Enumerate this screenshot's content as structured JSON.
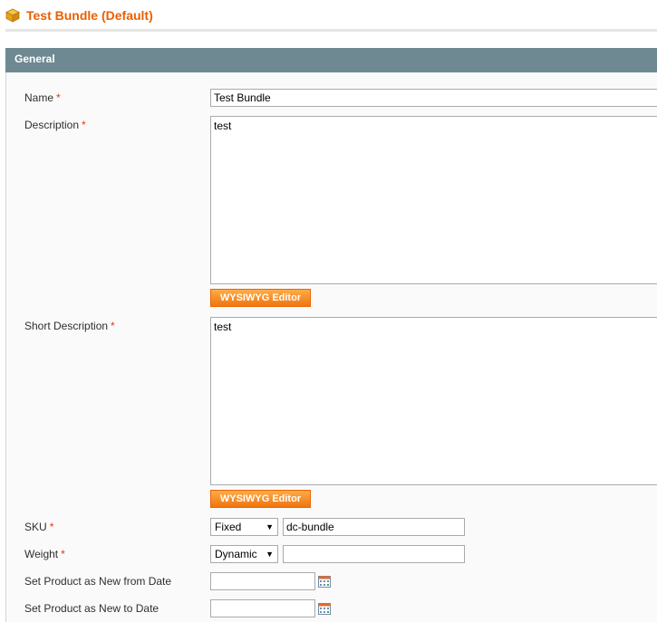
{
  "header": {
    "title": "Test Bundle (Default)",
    "icon": "product-box-icon"
  },
  "fieldset": {
    "title": "General"
  },
  "required_mark": "*",
  "fields": {
    "name": {
      "label": "Name",
      "value": "Test Bundle"
    },
    "description": {
      "label": "Description",
      "value": "test",
      "editor_button": "WYSIWYG Editor"
    },
    "short_description": {
      "label": "Short Description",
      "value": "test",
      "editor_button": "WYSIWYG Editor"
    },
    "sku": {
      "label": "SKU",
      "type_selected": "Fixed",
      "value": "dc-bundle"
    },
    "weight": {
      "label": "Weight",
      "type_selected": "Dynamic",
      "value": ""
    },
    "news_from_date": {
      "label": "Set Product as New from Date",
      "value": "",
      "icon": "calendar-icon"
    },
    "news_to_date": {
      "label": "Set Product as New to Date",
      "value": "",
      "icon": "calendar-icon"
    }
  },
  "colors": {
    "accent": "#eb5e00",
    "section_header": "#6f8992",
    "button": "#f0750f",
    "required": "#eb340a"
  }
}
